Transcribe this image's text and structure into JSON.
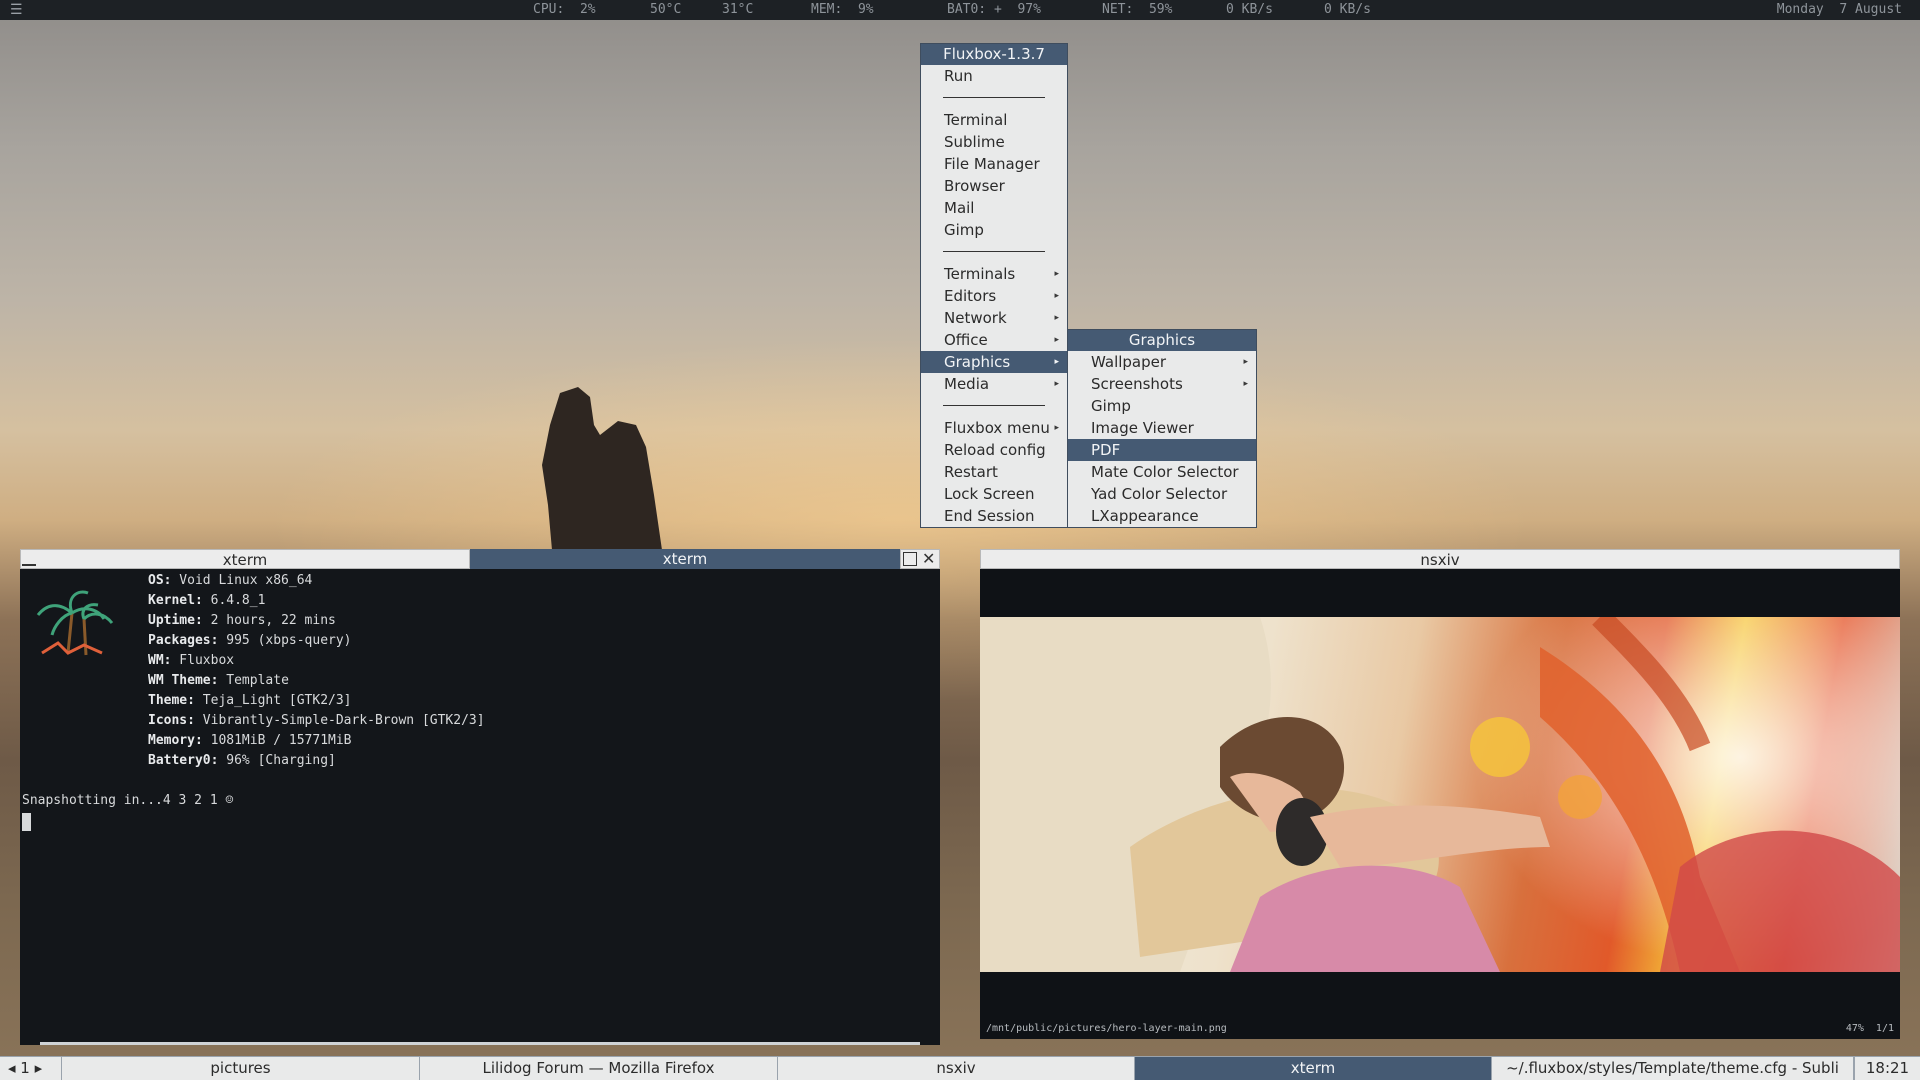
{
  "topbar": {
    "cpu": "CPU:  2%",
    "temp1": "50°C",
    "temp2": "31°C",
    "mem": "MEM:  9%",
    "battery": "BAT0: +  97%",
    "net": "NET:  59%",
    "net_down": "0 KB/s",
    "net_up": "0 KB/s",
    "date": "Monday  7 August"
  },
  "root_menu": {
    "title": "Fluxbox-1.3.7",
    "run": "Run",
    "apps": [
      "Terminal",
      "Sublime",
      "File Manager",
      "Browser",
      "Mail",
      "Gimp"
    ],
    "submenus": [
      "Terminals",
      "Editors",
      "Network",
      "Office",
      "Graphics",
      "Media"
    ],
    "system": [
      "Fluxbox menu",
      "Reload config",
      "Restart",
      "Lock Screen",
      "End Session"
    ]
  },
  "graphics_menu": {
    "title": "Graphics",
    "items": [
      "Wallpaper",
      "Screenshots",
      "Gimp",
      "Image Viewer",
      "PDF",
      "Mate Color Selector",
      "Yad Color Selector",
      "LXappearance"
    ]
  },
  "xterm": {
    "tab1_title": "xterm",
    "tab2_title": "xterm",
    "info": [
      {
        "key": "OS:",
        "val": " Void Linux x86_64"
      },
      {
        "key": "Kernel:",
        "val": " 6.4.8_1"
      },
      {
        "key": "Uptime:",
        "val": " 2 hours, 22 mins"
      },
      {
        "key": "Packages:",
        "val": " 995 (xbps-query)"
      },
      {
        "key": "WM:",
        "val": " Fluxbox"
      },
      {
        "key": "WM Theme:",
        "val": " Template"
      },
      {
        "key": "Theme:",
        "val": " Teja_Light [GTK2/3]"
      },
      {
        "key": "Icons:",
        "val": " Vibrantly-Simple-Dark-Brown [GTK2/3]"
      },
      {
        "key": "Memory:",
        "val": " 1081MiB / 15771MiB"
      },
      {
        "key": "Battery0:",
        "val": " 96% [Charging]"
      }
    ],
    "snapshot_line": "Snapshotting in...4 3 2 1 ☺"
  },
  "nsxiv": {
    "title": "nsxiv",
    "path": "/mnt/public/pictures/hero-layer-main.png",
    "info": "47%  1/1"
  },
  "taskbar": {
    "workspace": "◂ 1 ▸",
    "tasks": [
      "pictures",
      "Lilidog Forum — Mozilla Firefox",
      "nsxiv",
      "xterm",
      "~/.fluxbox/styles/Template/theme.cfg - Subli"
    ],
    "clock": "18:21"
  }
}
